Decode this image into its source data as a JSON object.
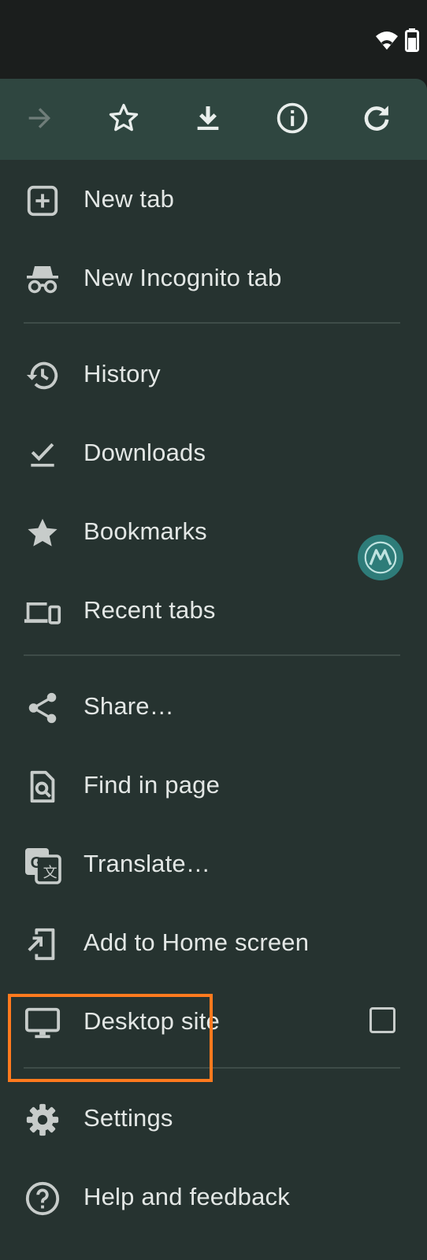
{
  "toolbar": {
    "icons": [
      "forward-icon",
      "bookmark-star-icon",
      "download-icon",
      "info-icon",
      "refresh-icon"
    ]
  },
  "menu": {
    "items": [
      {
        "label": "New tab",
        "icon": "new-tab-icon"
      },
      {
        "label": "New Incognito tab",
        "icon": "incognito-icon"
      },
      {
        "label": "History",
        "icon": "history-icon"
      },
      {
        "label": "Downloads",
        "icon": "downloads-icon"
      },
      {
        "label": "Bookmarks",
        "icon": "bookmarks-star-icon"
      },
      {
        "label": "Recent tabs",
        "icon": "recent-tabs-icon"
      },
      {
        "label": "Share…",
        "icon": "share-icon"
      },
      {
        "label": "Find in page",
        "icon": "find-in-page-icon"
      },
      {
        "label": "Translate…",
        "icon": "translate-icon"
      },
      {
        "label": "Add to Home screen",
        "icon": "add-to-home-icon"
      },
      {
        "label": "Desktop site",
        "icon": "desktop-icon",
        "checked": false
      },
      {
        "label": "Settings",
        "icon": "settings-gear-icon",
        "highlighted": true
      },
      {
        "label": "Help and feedback",
        "icon": "help-icon"
      }
    ]
  },
  "colors": {
    "menu_bg": "#263330",
    "toolbar_bg": "#2f4640",
    "text": "#e3e7e5",
    "icon": "#c7ccca",
    "highlight": "#ff7a1e"
  }
}
